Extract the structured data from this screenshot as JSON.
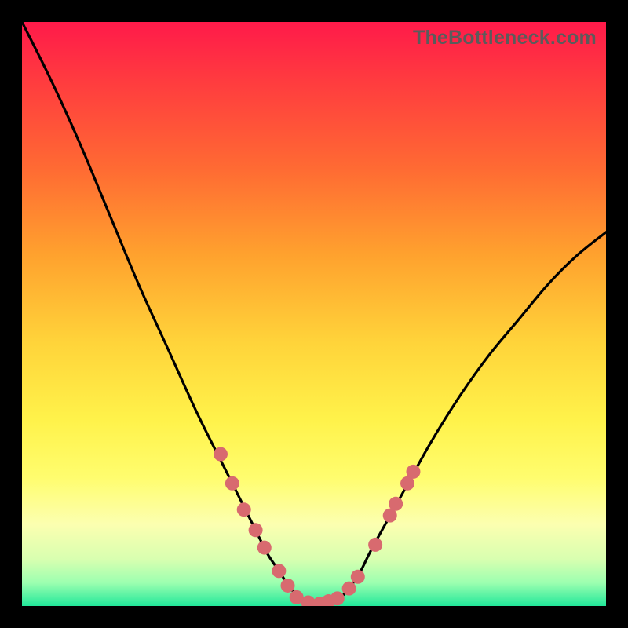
{
  "watermark": {
    "text": "TheBottleneck.com"
  },
  "chart_data": {
    "type": "line",
    "title": "",
    "xlabel": "",
    "ylabel": "",
    "xlim": [
      0,
      100
    ],
    "ylim": [
      0,
      100
    ],
    "grid": false,
    "legend": false,
    "series": [
      {
        "name": "bottleneck-curve",
        "color": "#000000",
        "x": [
          0,
          5,
          10,
          15,
          20,
          25,
          30,
          35,
          40,
          42,
          44,
          46,
          48,
          50,
          52,
          54,
          56,
          58,
          60,
          65,
          70,
          75,
          80,
          85,
          90,
          95,
          100
        ],
        "y": [
          100,
          90,
          79,
          67,
          55,
          44,
          33,
          23,
          13,
          9,
          6,
          3,
          1,
          0.3,
          0.3,
          1,
          3,
          6,
          10,
          19,
          28,
          36,
          43,
          49,
          55,
          60,
          64
        ]
      }
    ],
    "markers": [
      {
        "name": "curve-dots",
        "color": "#d86a6f",
        "radius": 9,
        "points": [
          {
            "x": 34,
            "y": 26
          },
          {
            "x": 36,
            "y": 21
          },
          {
            "x": 38,
            "y": 16.5
          },
          {
            "x": 40,
            "y": 13
          },
          {
            "x": 41.5,
            "y": 10
          },
          {
            "x": 44,
            "y": 6
          },
          {
            "x": 45.5,
            "y": 3.5
          },
          {
            "x": 47,
            "y": 1.5
          },
          {
            "x": 49,
            "y": 0.6
          },
          {
            "x": 51,
            "y": 0.4
          },
          {
            "x": 52.5,
            "y": 0.8
          },
          {
            "x": 54,
            "y": 1.3
          },
          {
            "x": 56,
            "y": 3
          },
          {
            "x": 57.5,
            "y": 5
          },
          {
            "x": 60.5,
            "y": 10.5
          },
          {
            "x": 63,
            "y": 15.5
          },
          {
            "x": 64,
            "y": 17.5
          },
          {
            "x": 66,
            "y": 21
          },
          {
            "x": 67,
            "y": 23
          }
        ]
      }
    ],
    "gradient_stops": [
      {
        "pos": 0,
        "color": "#ff1a4a"
      },
      {
        "pos": 10,
        "color": "#ff3b3f"
      },
      {
        "pos": 25,
        "color": "#ff6a33"
      },
      {
        "pos": 40,
        "color": "#ffa22e"
      },
      {
        "pos": 55,
        "color": "#ffd43a"
      },
      {
        "pos": 68,
        "color": "#fff24a"
      },
      {
        "pos": 78,
        "color": "#fffd6e"
      },
      {
        "pos": 86,
        "color": "#fcffb0"
      },
      {
        "pos": 92,
        "color": "#d8ffb0"
      },
      {
        "pos": 96,
        "color": "#9dffb0"
      },
      {
        "pos": 100,
        "color": "#22e89a"
      }
    ]
  }
}
